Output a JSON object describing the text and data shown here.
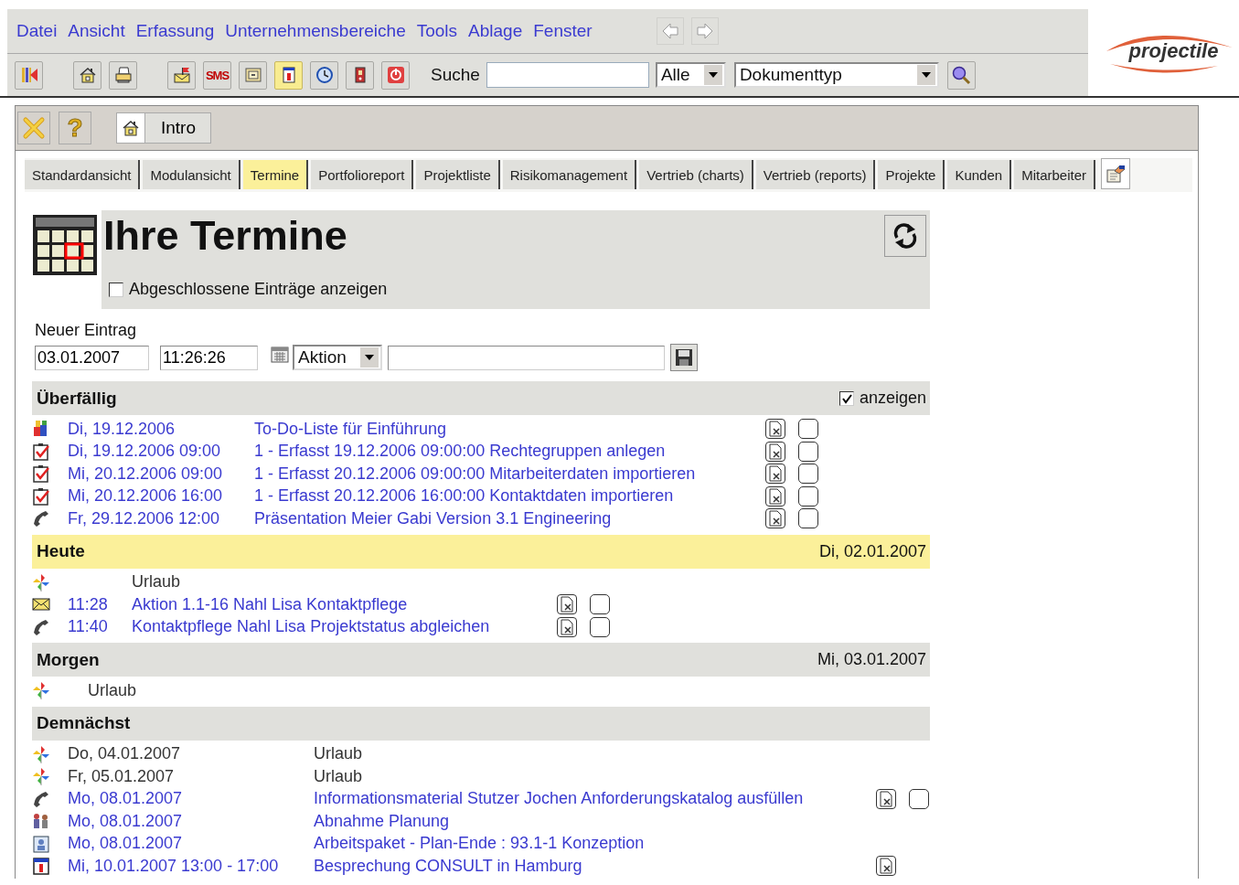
{
  "menu": [
    "Datei",
    "Ansicht",
    "Erfassung",
    "Unternehmensbereiche",
    "Tools",
    "Ablage",
    "Fenster"
  ],
  "tool_buttons": [
    {
      "kind": "exit",
      "selected": false
    },
    {
      "kind": "home",
      "selected": false
    },
    {
      "kind": "printer",
      "selected": false
    },
    {
      "kind": "mail",
      "selected": false
    },
    {
      "kind": "sms",
      "label": "SMS",
      "selected": false
    },
    {
      "kind": "box",
      "selected": false
    },
    {
      "kind": "calendar",
      "selected": true
    },
    {
      "kind": "clock",
      "selected": false
    },
    {
      "kind": "binder",
      "selected": false
    },
    {
      "kind": "power",
      "selected": false
    }
  ],
  "search": {
    "label": "Suche",
    "scope": "Alle",
    "doc_type": "Dokumenttyp"
  },
  "logo": "projectile",
  "panel_toolbar": {
    "help": "?",
    "intro": "Intro"
  },
  "tabs": [
    {
      "label": "Standardansicht",
      "selected": false
    },
    {
      "label": "Modulansicht",
      "selected": false
    },
    {
      "label": "Termine",
      "selected": true
    },
    {
      "label": "Portfolioreport",
      "selected": false
    },
    {
      "label": "Projektliste",
      "selected": false
    },
    {
      "label": "Risikomanagement",
      "selected": false
    },
    {
      "label": "Vertrieb (charts)",
      "selected": false
    },
    {
      "label": "Vertrieb (reports)",
      "selected": false
    },
    {
      "label": "Projekte",
      "selected": false
    },
    {
      "label": "Kunden",
      "selected": false
    },
    {
      "label": "Mitarbeiter",
      "selected": false
    }
  ],
  "title": "Ihre Termine",
  "show_closed": {
    "label": "Abgeschlossene Einträge anzeigen",
    "checked": false
  },
  "new_entry": {
    "label": "Neuer Eintrag",
    "date": "03.01.2007",
    "time": "11:26:26",
    "type": "Aktion"
  },
  "sections": [
    {
      "kind": "overdue",
      "title": "Überfällig",
      "highlighted": false,
      "show": {
        "label": "anzeigen",
        "checked": true
      },
      "rows": [
        {
          "kind": "group",
          "date": "Di, 19.12.2006",
          "text": "To-Do-Liste für Einführung",
          "link": true,
          "delete": true,
          "done": {
            "checked": false
          }
        },
        {
          "kind": "task",
          "date": "Di, 19.12.2006 09:00",
          "text": "1 - Erfasst 19.12.2006 09:00:00 Rechtegruppen anlegen",
          "link": true,
          "delete": true,
          "done": {
            "checked": false
          }
        },
        {
          "kind": "task",
          "date": "Mi, 20.12.2006 09:00",
          "text": "1 - Erfasst 20.12.2006 09:00:00 Mitarbeiterdaten importieren",
          "link": true,
          "delete": true,
          "done": {
            "checked": false
          }
        },
        {
          "kind": "task",
          "date": "Mi, 20.12.2006 16:00",
          "text": "1 - Erfasst 20.12.2006 16:00:00 Kontaktdaten importieren",
          "link": true,
          "delete": true,
          "done": {
            "checked": false
          }
        },
        {
          "kind": "phone",
          "date": "Fr, 29.12.2006 12:00",
          "text": "Präsentation Meier Gabi Version 3.1 Engineering",
          "link": true,
          "delete": true,
          "done": {
            "checked": false
          }
        }
      ]
    },
    {
      "kind": "today",
      "title": "Heute",
      "date": "Di, 02.01.2007",
      "highlighted": true,
      "rows": [
        {
          "kind": "vacation",
          "text": "Urlaub",
          "link": false,
          "delete": false
        },
        {
          "kind": "mail",
          "date": "11:28",
          "text": "Aktion 1.1-16 Nahl Lisa Kontaktpflege",
          "link": true,
          "delete": true,
          "done": {
            "checked": false
          }
        },
        {
          "kind": "phone",
          "date": "11:40",
          "text": "Kontaktpflege Nahl Lisa Projektstatus abgleichen",
          "link": true,
          "delete": true,
          "done": {
            "checked": false
          }
        }
      ]
    },
    {
      "kind": "tomorrow",
      "title": "Morgen",
      "date": "Mi, 03.01.2007",
      "highlighted": false,
      "rows": [
        {
          "kind": "vacation",
          "text": "Urlaub",
          "link": false
        }
      ]
    },
    {
      "kind": "upcoming",
      "title": "Demnächst",
      "highlighted": false,
      "rows": [
        {
          "kind": "vacation",
          "date": "Do, 04.01.2007",
          "text": "Urlaub",
          "link": false,
          "delete": false
        },
        {
          "kind": "vacation",
          "date": "Fr, 05.01.2007",
          "text": "Urlaub",
          "link": false,
          "delete": false
        },
        {
          "kind": "phone",
          "date": "Mo, 08.01.2007",
          "text": "Informationsmaterial Stutzer Jochen Anforderungskatalog ausfüllen",
          "link": true,
          "delete": true,
          "done": {
            "checked": false
          }
        },
        {
          "kind": "meeting",
          "date": "Mo, 08.01.2007",
          "text": "Abnahme Planung",
          "link": true,
          "delete": false
        },
        {
          "kind": "workpackage",
          "date": "Mo, 08.01.2007",
          "text": "Arbeitspaket - Plan-Ende : 93.1-1 Konzeption",
          "link": true,
          "delete": false
        },
        {
          "kind": "calendar",
          "date": "Mi, 10.01.2007 13:00 - 17:00",
          "text": "Besprechung CONSULT in Hamburg",
          "link": true,
          "delete": true
        }
      ]
    }
  ]
}
